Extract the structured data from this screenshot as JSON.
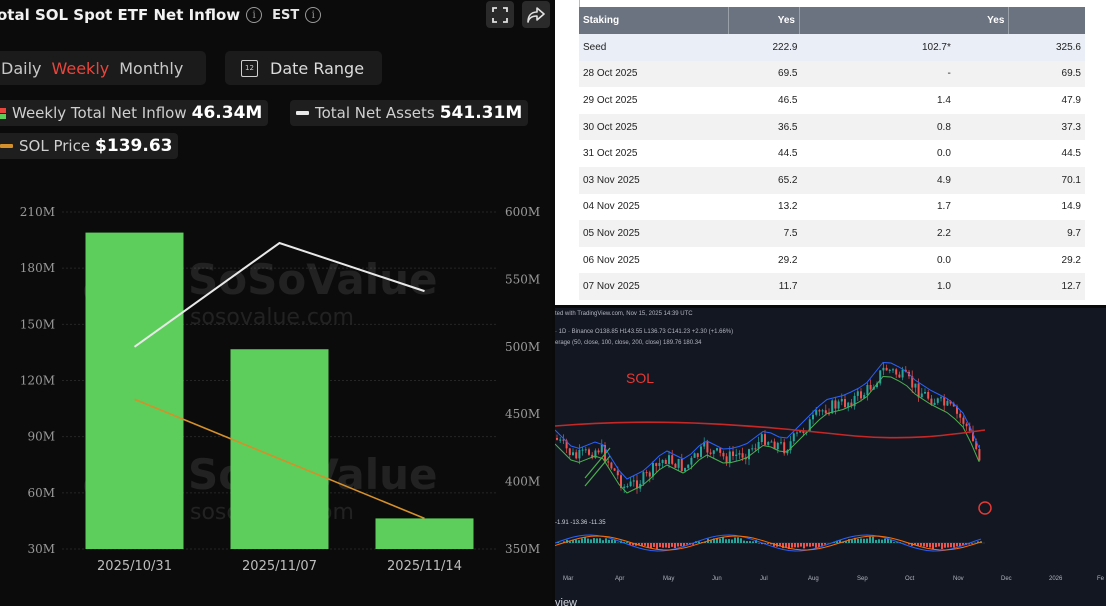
{
  "left_panel": {
    "title": "otal SOL Spot ETF Net Inflow",
    "timezone": "EST",
    "tabs": [
      "Daily",
      "Weekly",
      "Monthly"
    ],
    "active_tab": "Weekly",
    "date_range_label": "Date Range",
    "legend": {
      "weekly_inflow_label": "Weekly Total Net Inflow",
      "weekly_inflow_value": "46.34M",
      "total_net_assets_label": "Total Net Assets",
      "total_net_assets_value": "541.31M",
      "sol_price_label": "SOL Price",
      "sol_price_value": "$139.63"
    },
    "watermark_lines": [
      "SoSoValue",
      "sosovalue.com"
    ],
    "colors": {
      "bar": "#5dce5b",
      "net_assets_line": "#e8e8e8",
      "sol_price_line": "#d4902a",
      "active_tab": "#e8453c"
    }
  },
  "chart_data": {
    "type": "bar",
    "categories": [
      "2025/10/31",
      "2025/11/07",
      "2025/11/14"
    ],
    "series": [
      {
        "name": "Weekly Total Net Inflow",
        "type": "bar",
        "axis": "left",
        "values": [
          199,
          136.7,
          46.34
        ]
      },
      {
        "name": "Total Net Assets",
        "type": "line",
        "axis": "right",
        "values": [
          500,
          577,
          541.31
        ]
      },
      {
        "name": "SOL Price",
        "type": "line",
        "axis": "left",
        "values": [
          110,
          null,
          46.34
        ]
      }
    ],
    "y_left": {
      "ticks": [
        "210M",
        "180M",
        "150M",
        "120M",
        "90M",
        "60M",
        "30M"
      ],
      "range": [
        30,
        210
      ]
    },
    "y_right": {
      "ticks": [
        "600M",
        "550M",
        "500M",
        "450M",
        "400M",
        "350M"
      ],
      "range": [
        350,
        600
      ]
    },
    "grid": true,
    "legend": "top-left"
  },
  "table": {
    "columns": [
      "Staking",
      "Yes",
      "Yes",
      ""
    ],
    "rows": [
      [
        "Seed",
        "222.9",
        "102.7*",
        "325.6"
      ],
      [
        "28 Oct 2025",
        "69.5",
        "-",
        "69.5"
      ],
      [
        "29 Oct 2025",
        "46.5",
        "1.4",
        "47.9"
      ],
      [
        "30 Oct 2025",
        "36.5",
        "0.8",
        "37.3"
      ],
      [
        "31 Oct 2025",
        "44.5",
        "0.0",
        "44.5"
      ],
      [
        "03 Nov 2025",
        "65.2",
        "4.9",
        "70.1"
      ],
      [
        "04 Nov 2025",
        "13.2",
        "1.7",
        "14.9"
      ],
      [
        "05 Nov 2025",
        "7.5",
        "2.2",
        "9.7"
      ],
      [
        "06 Nov 2025",
        "29.2",
        "0.0",
        "29.2"
      ],
      [
        "07 Nov 2025",
        "11.7",
        "1.0",
        "12.7"
      ]
    ]
  },
  "tradingview": {
    "header": "ted with TradingView.com, Nov 15, 2025 14:39 UTC",
    "symbol_line": "· 1D · Binance  O138.85 H143.55 L136.73 C141.23 +2.30 (+1.66%)",
    "ma_line": "erage (50, close, 100, close, 200, close)  189.76  180.34",
    "label": "SOL",
    "macd_values": "-1.91  -13.36  -11.35",
    "months": [
      "Mar",
      "Apr",
      "May",
      "Jun",
      "Jul",
      "Aug",
      "Sep",
      "Oct",
      "Nov",
      "Dec",
      "2026",
      "Fe"
    ],
    "footer": "view"
  }
}
